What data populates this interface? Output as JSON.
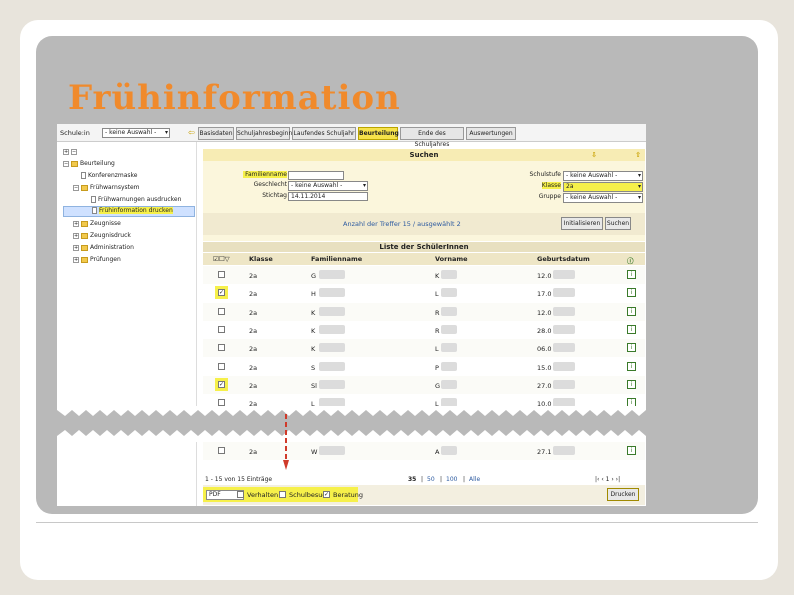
{
  "slide": {
    "title": "Frühinformation"
  },
  "topbar": {
    "schule_label": "Schule:in",
    "schule_value": "- keine Auswahl -",
    "tabs": [
      "Basisdaten",
      "Schuljahresbeginn",
      "Laufendes Schuljahr",
      "Beurteilung",
      "Ende des Schuljahres",
      "Auswertungen"
    ],
    "active_tab": "Beurteilung"
  },
  "tree": {
    "items": [
      "Beurteilung",
      "Konferenzmaske",
      "Frühwarnsystem",
      "Frühwarnungen ausdrucken",
      "Frühinformation drucken",
      "Zeugnisse",
      "Zeugnisdruck",
      "Administration",
      "Prüfungen"
    ]
  },
  "search": {
    "title": "Suchen",
    "familienname_label": "Familienname",
    "familienname_value": "",
    "geschlecht_label": "Geschlecht",
    "geschlecht_value": "- keine Auswahl -",
    "stichtag_label": "Stichtag",
    "stichtag_value": "14.11.2014",
    "schulstufe_label": "Schulstufe",
    "schulstufe_value": "- keine Auswahl -",
    "klasse_label": "Klasse",
    "klasse_value": "2a",
    "gruppe_label": "Gruppe",
    "gruppe_value": "- keine Auswahl -",
    "treffer_text": "Anzahl der Treffer  15 / ausgewählt  2",
    "initialisieren": "Initialisieren",
    "suchen": "Suchen"
  },
  "list": {
    "title": "Liste der SchülerInnen",
    "columns": {
      "klasse": "Klasse",
      "familienname": "Familienname",
      "vorname": "Vorname",
      "geburtsdatum": "Geburtsdatum"
    },
    "rows": [
      {
        "checked": false,
        "klasse": "2a",
        "fam": "G",
        "vor": "K",
        "geb": "12.0"
      },
      {
        "checked": true,
        "klasse": "2a",
        "fam": "H",
        "vor": "L",
        "geb": "17.0"
      },
      {
        "checked": false,
        "klasse": "2a",
        "fam": "K",
        "vor": "R",
        "geb": "12.0"
      },
      {
        "checked": false,
        "klasse": "2a",
        "fam": "K",
        "vor": "R",
        "geb": "28.0"
      },
      {
        "checked": false,
        "klasse": "2a",
        "fam": "K",
        "vor": "L",
        "geb": "06.0"
      },
      {
        "checked": false,
        "klasse": "2a",
        "fam": "S",
        "vor": "P",
        "geb": "15.0"
      },
      {
        "checked": true,
        "klasse": "2a",
        "fam": "Sl",
        "vor": "G",
        "geb": "27.0"
      },
      {
        "checked": false,
        "klasse": "2a",
        "fam": "L",
        "vor": "L",
        "geb": "10.0"
      },
      {
        "checked": false,
        "klasse": "2a",
        "fam": "W",
        "vor": "A",
        "geb": "27.1"
      }
    ]
  },
  "footer": {
    "range_text": "1 - 15 von 15 Einträge",
    "page_sizes": [
      "35",
      "50",
      "100",
      "Alle"
    ],
    "pager": "|‹  ‹  1  ›  ›|",
    "format": "PDF",
    "verhalten": "Verhalten",
    "schulbesuch": "Schulbesuch",
    "beratung": "Beratung",
    "drucken": "Drucken"
  },
  "colors": {
    "title": "#f08a2c",
    "highlight": "#f6f04a",
    "active_tab": "#f6e24a"
  }
}
